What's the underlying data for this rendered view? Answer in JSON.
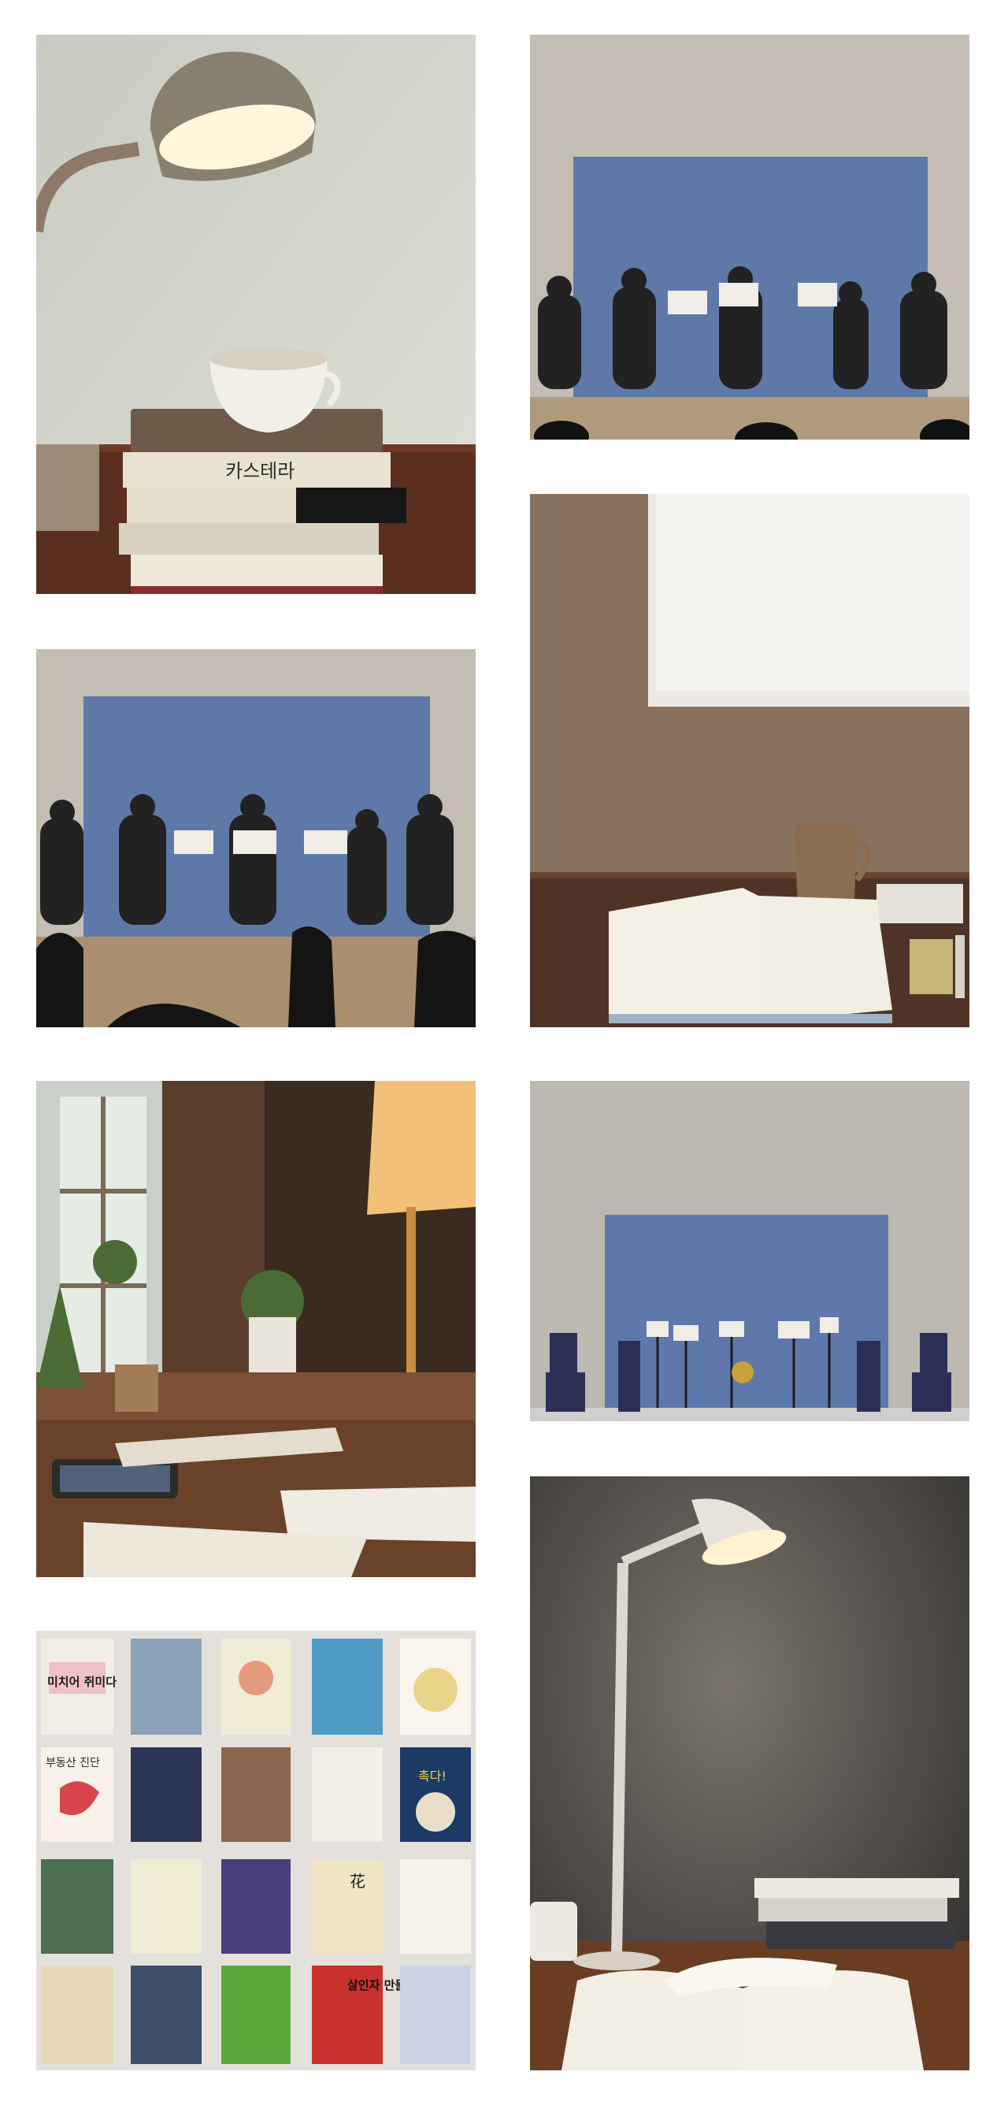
{
  "gallery": {
    "tiles": [
      {
        "name": "desk-lamp-coffee-books-photo",
        "spine_text": "카스테라"
      },
      {
        "name": "wind-ensemble-stage-photo"
      },
      {
        "name": "wind-ensemble-audience-photo"
      },
      {
        "name": "reading-desk-window-photo"
      },
      {
        "name": "study-room-lamp-photo"
      },
      {
        "name": "empty-stage-chairs-photo"
      },
      {
        "name": "book-cover-grid-photo",
        "covers": [
          "미치어 쥐미다",
          "",
          "",
          "",
          "",
          "부동산 진단",
          "",
          "",
          "",
          "촉다!",
          "",
          "",
          "",
          "花",
          "",
          "",
          "",
          "",
          "살인자 만들기",
          ""
        ]
      },
      {
        "name": "reading-lamp-open-book-photo"
      }
    ]
  }
}
